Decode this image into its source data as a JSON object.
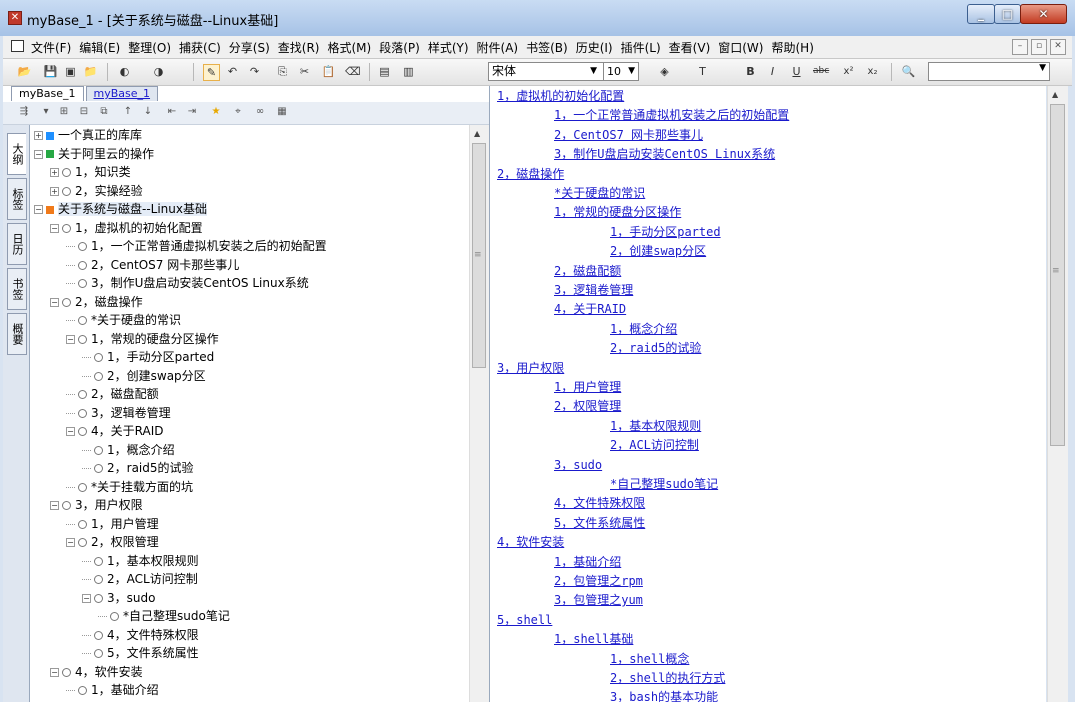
{
  "window": {
    "title": "myBase_1 - [关于系统与磁盘--Linux基础]"
  },
  "menu": [
    "文件(F)",
    "编辑(E)",
    "整理(O)",
    "捕获(C)",
    "分享(S)",
    "查找(R)",
    "格式(M)",
    "段落(P)",
    "样式(Y)",
    "附件(A)",
    "书签(B)",
    "历史(I)",
    "插件(L)",
    "查看(V)",
    "窗口(W)",
    "帮助(H)"
  ],
  "toolbar": {
    "font": "宋体",
    "size": "10"
  },
  "tabs": [
    "myBase_1",
    "myBase_1"
  ],
  "vtabs": [
    "大纲",
    "标签",
    "日历",
    "书签",
    "概要"
  ],
  "tree": {
    "nodes": [
      {
        "text": "一个真正的库库",
        "level": 0,
        "exp": "+",
        "icon": "blue"
      },
      {
        "text": "关于阿里云的操作",
        "level": 0,
        "exp": "-",
        "icon": "green"
      },
      {
        "text": "1，知识类",
        "level": 1,
        "exp": "+",
        "icon": "gear"
      },
      {
        "text": "2，实操经验",
        "level": 1,
        "exp": "+",
        "icon": "gear"
      },
      {
        "text": "关于系统与磁盘--Linux基础",
        "level": 0,
        "exp": "-",
        "icon": "orange"
      },
      {
        "text": "1，虚拟机的初始化配置",
        "level": 1,
        "exp": "-",
        "icon": "gear"
      },
      {
        "text": "1，一个正常普通虚拟机安装之后的初始配置",
        "level": 2,
        "exp": "",
        "icon": "gear"
      },
      {
        "text": "2，CentOS7 网卡那些事儿",
        "level": 2,
        "exp": "",
        "icon": "gear"
      },
      {
        "text": "3，制作U盘启动安装CentOS Linux系统",
        "level": 2,
        "exp": "",
        "icon": "gear"
      },
      {
        "text": "2，磁盘操作",
        "level": 1,
        "exp": "-",
        "icon": "gear"
      },
      {
        "text": "*关于硬盘的常识",
        "level": 2,
        "exp": "",
        "icon": "gear"
      },
      {
        "text": "1，常规的硬盘分区操作",
        "level": 2,
        "exp": "-",
        "icon": "gear"
      },
      {
        "text": "1，手动分区parted",
        "level": 3,
        "exp": "",
        "icon": "gear"
      },
      {
        "text": "2，创建swap分区",
        "level": 3,
        "exp": "",
        "icon": "gear"
      },
      {
        "text": "2，磁盘配额",
        "level": 2,
        "exp": "",
        "icon": "gear"
      },
      {
        "text": "3，逻辑卷管理",
        "level": 2,
        "exp": "",
        "icon": "gear"
      },
      {
        "text": "4，关于RAID",
        "level": 2,
        "exp": "-",
        "icon": "gear"
      },
      {
        "text": "1，概念介绍",
        "level": 3,
        "exp": "",
        "icon": "gear"
      },
      {
        "text": "2，raid5的试验",
        "level": 3,
        "exp": "",
        "icon": "gear"
      },
      {
        "text": "*关于挂载方面的坑",
        "level": 2,
        "exp": "",
        "icon": "gear"
      },
      {
        "text": "3，用户权限",
        "level": 1,
        "exp": "-",
        "icon": "gear"
      },
      {
        "text": "1，用户管理",
        "level": 2,
        "exp": "",
        "icon": "gear"
      },
      {
        "text": "2，权限管理",
        "level": 2,
        "exp": "-",
        "icon": "gear"
      },
      {
        "text": "1，基本权限规则",
        "level": 3,
        "exp": "",
        "icon": "gear"
      },
      {
        "text": "2，ACL访问控制",
        "level": 3,
        "exp": "",
        "icon": "gear"
      },
      {
        "text": "3，sudo",
        "level": 3,
        "exp": "-",
        "icon": "gear"
      },
      {
        "text": "*自己整理sudo笔记",
        "level": 4,
        "exp": "",
        "icon": "gear"
      },
      {
        "text": "4，文件特殊权限",
        "level": 3,
        "exp": "",
        "icon": "gear"
      },
      {
        "text": "5，文件系统属性",
        "level": 3,
        "exp": "",
        "icon": "gear"
      },
      {
        "text": "4，软件安装",
        "level": 1,
        "exp": "-",
        "icon": "gear"
      },
      {
        "text": "1，基础介绍",
        "level": 2,
        "exp": "",
        "icon": "gear"
      }
    ]
  },
  "content": {
    "links": [
      {
        "text": "1，虚拟机的初始化配置",
        "level": 0
      },
      {
        "text": "1，一个正常普通虚拟机安装之后的初始配置",
        "level": 1
      },
      {
        "text": "2，CentOS7 网卡那些事儿",
        "level": 1
      },
      {
        "text": "3，制作U盘启动安装CentOS Linux系统",
        "level": 1
      },
      {
        "text": "2，磁盘操作",
        "level": 0
      },
      {
        "text": "*关于硬盘的常识",
        "level": 1
      },
      {
        "text": "1，常规的硬盘分区操作",
        "level": 1
      },
      {
        "text": "1，手动分区parted",
        "level": 2
      },
      {
        "text": "2，创建swap分区",
        "level": 2
      },
      {
        "text": "2，磁盘配额",
        "level": 1
      },
      {
        "text": "3，逻辑卷管理",
        "level": 1
      },
      {
        "text": "4，关于RAID",
        "level": 1
      },
      {
        "text": "1，概念介绍",
        "level": 2
      },
      {
        "text": "2，raid5的试验",
        "level": 2
      },
      {
        "text": "3，用户权限",
        "level": 0
      },
      {
        "text": "1，用户管理",
        "level": 1
      },
      {
        "text": "2，权限管理",
        "level": 1
      },
      {
        "text": "1，基本权限规则",
        "level": 2
      },
      {
        "text": "2，ACL访问控制",
        "level": 2
      },
      {
        "text": "3，sudo",
        "level": 1
      },
      {
        "text": "*自己整理sudo笔记",
        "level": 2
      },
      {
        "text": "4，文件特殊权限",
        "level": 1
      },
      {
        "text": "5，文件系统属性",
        "level": 1
      },
      {
        "text": "4，软件安装",
        "level": 0
      },
      {
        "text": "1，基础介绍",
        "level": 1
      },
      {
        "text": "2，包管理之rpm",
        "level": 1
      },
      {
        "text": "3，包管理之yum",
        "level": 1
      },
      {
        "text": "5，shell",
        "level": 0
      },
      {
        "text": "1，shell基础",
        "level": 1
      },
      {
        "text": "1，shell概念",
        "level": 2
      },
      {
        "text": "2，shell的执行方式",
        "level": 2
      },
      {
        "text": "3，bash的基本功能",
        "level": 2
      }
    ]
  },
  "colors": {
    "blue": "#1e90ff",
    "green": "#27a844",
    "orange": "#f07a1a"
  }
}
